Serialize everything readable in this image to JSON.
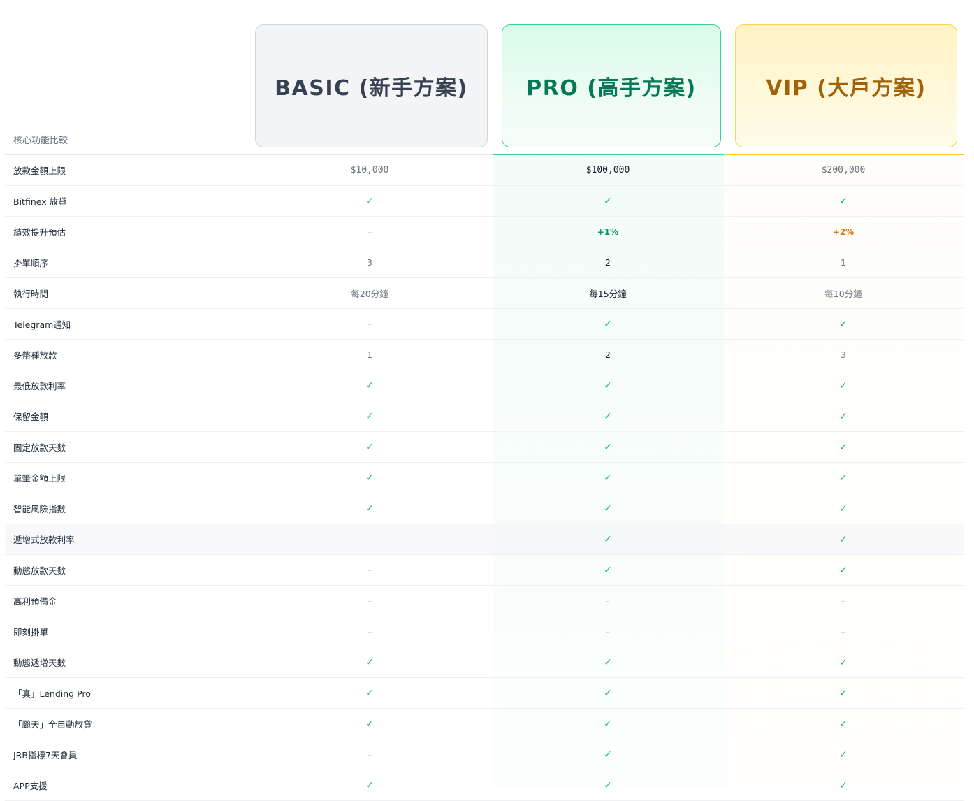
{
  "plans": {
    "basic": {
      "title": "BASIC (新手方案)"
    },
    "pro": {
      "title": "PRO (高手方案)"
    },
    "vip": {
      "title": "VIP (大戶方案)"
    }
  },
  "section_label": "核心功能比較",
  "rows": [
    {
      "name": "放款金額上限",
      "basic": "$10,000",
      "pro": "$100,000",
      "vip": "$200,000",
      "kind": "money"
    },
    {
      "name": "Bitfinex 放貸",
      "basic": "✓",
      "pro": "✓",
      "vip": "✓"
    },
    {
      "name": "績效提升預估",
      "basic": "–",
      "pro": "+1%",
      "vip": "+2%",
      "kind": "boost"
    },
    {
      "name": "掛單順序",
      "basic": "3",
      "pro": "2",
      "vip": "1"
    },
    {
      "name": "執行時間",
      "basic": "每20分鐘",
      "pro": "每15分鐘",
      "vip": "每10分鐘"
    },
    {
      "name": "Telegram通知",
      "basic": "–",
      "pro": "✓",
      "vip": "✓"
    },
    {
      "name": "多幣種放款",
      "basic": "1",
      "pro": "2",
      "vip": "3"
    },
    {
      "name": "最低放款利率",
      "basic": "✓",
      "pro": "✓",
      "vip": "✓"
    },
    {
      "name": "保留金額",
      "basic": "✓",
      "pro": "✓",
      "vip": "✓"
    },
    {
      "name": "固定放款天數",
      "basic": "✓",
      "pro": "✓",
      "vip": "✓"
    },
    {
      "name": "單筆金額上限",
      "basic": "✓",
      "pro": "✓",
      "vip": "✓"
    },
    {
      "name": "智能風險指數",
      "basic": "✓",
      "pro": "✓",
      "vip": "✓"
    },
    {
      "name": "遞增式放款利率",
      "basic": "–",
      "pro": "✓",
      "vip": "✓",
      "shaded": true
    },
    {
      "name": "動態放款天數",
      "basic": "–",
      "pro": "✓",
      "vip": "✓"
    },
    {
      "name": "高利預備金",
      "basic": "–",
      "pro": "–",
      "vip": "–"
    },
    {
      "name": "即刻掛單",
      "basic": "–",
      "pro": "–",
      "vip": "–"
    },
    {
      "name": "動態遞增天數",
      "basic": "✓",
      "pro": "✓",
      "vip": "✓"
    },
    {
      "name": "「真」Lending Pro",
      "basic": "✓",
      "pro": "✓",
      "vip": "✓"
    },
    {
      "name": "「颱天」全自動放貸",
      "basic": "✓",
      "pro": "✓",
      "vip": "✓"
    },
    {
      "name": "JRB指標7天會員",
      "basic": "–",
      "pro": "✓",
      "vip": "✓"
    },
    {
      "name": "APP支援",
      "basic": "✓",
      "pro": "✓",
      "vip": "✓"
    }
  ],
  "colors": {
    "check": "#10b981",
    "pro_accent": "#34d399",
    "vip_accent": "#facc15"
  }
}
